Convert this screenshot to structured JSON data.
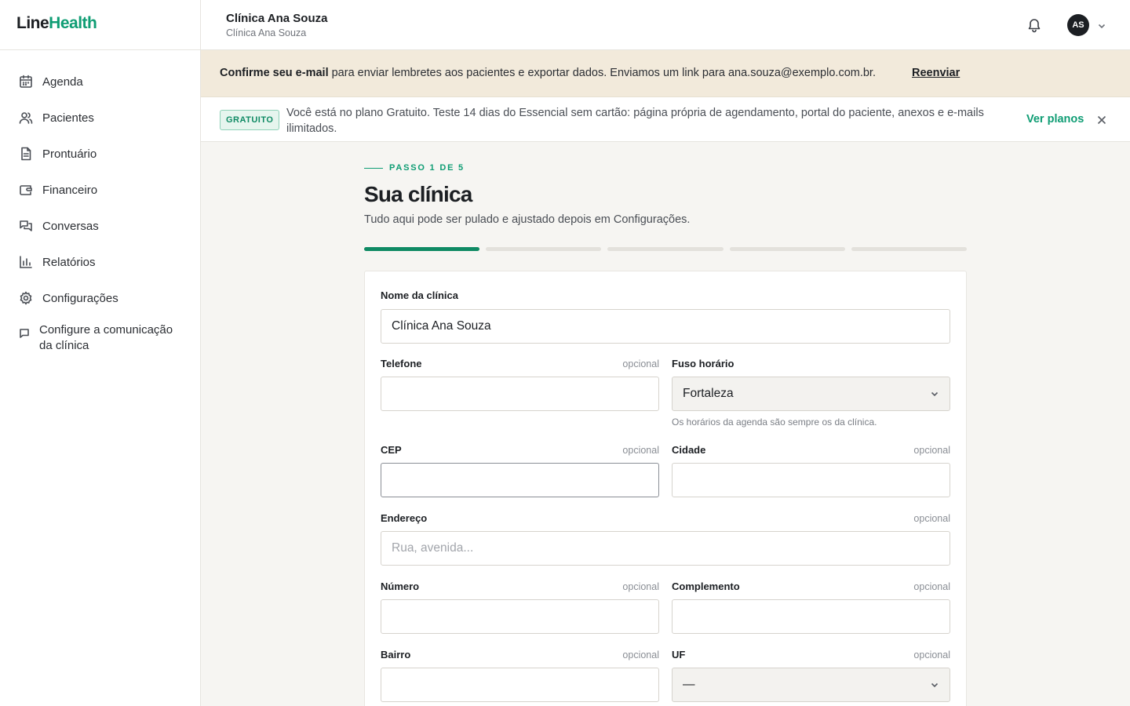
{
  "brand": {
    "part1": "Line",
    "part2": "Health"
  },
  "sidebar": {
    "items": [
      {
        "label": "Agenda",
        "icon": "calendar-icon"
      },
      {
        "label": "Pacientes",
        "icon": "users-icon"
      },
      {
        "label": "Prontuário",
        "icon": "file-icon"
      },
      {
        "label": "Financeiro",
        "icon": "wallet-icon"
      },
      {
        "label": "Conversas",
        "icon": "chat-icon"
      },
      {
        "label": "Relatórios",
        "icon": "bar-chart-icon"
      },
      {
        "label": "Configurações",
        "icon": "gear-icon"
      },
      {
        "label": "Configure a comunicação da clínica",
        "icon": "message-icon"
      }
    ]
  },
  "header": {
    "clinic_name": "Clínica Ana Souza",
    "clinic_sub": "Clínica Ana Souza",
    "avatar_initials": "AS"
  },
  "email_banner": {
    "bold": "Confirme seu e-mail",
    "text": " para enviar lembretes aos pacientes e exportar dados. Enviamos um link para ana.souza@exemplo.com.br.",
    "action": "Reenviar"
  },
  "plan_banner": {
    "badge": "GRATUITO",
    "text": "Você está no plano Gratuito. Teste 14 dias do Essencial sem cartão: página própria de agendamento, portal do paciente, anexos e e-mails ilimitados.",
    "action": "Ver planos"
  },
  "wizard": {
    "step": "PASSO 1 DE 5",
    "title": "Sua clínica",
    "subtitle": "Tudo aqui pode ser pulado e ajustado depois em Configurações.",
    "total_steps": 5,
    "current_step": 1
  },
  "form": {
    "optional_label": "opcional",
    "clinic_name": {
      "label": "Nome da clínica",
      "value": "Clínica Ana Souza"
    },
    "phone": {
      "label": "Telefone",
      "value": ""
    },
    "timezone": {
      "label": "Fuso horário",
      "value": "Fortaleza",
      "help": "Os horários da agenda são sempre os da clínica."
    },
    "cep": {
      "label": "CEP",
      "value": ""
    },
    "city": {
      "label": "Cidade",
      "value": ""
    },
    "address": {
      "label": "Endereço",
      "placeholder": "Rua, avenida..."
    },
    "number": {
      "label": "Número",
      "value": ""
    },
    "complement": {
      "label": "Complemento",
      "value": ""
    },
    "neighborhood": {
      "label": "Bairro",
      "value": ""
    },
    "state": {
      "label": "UF",
      "value": "—"
    }
  },
  "colors": {
    "accent": "#0f9d74",
    "banner_bg": "#f2eadb",
    "page_bg": "#f6f5f2"
  }
}
